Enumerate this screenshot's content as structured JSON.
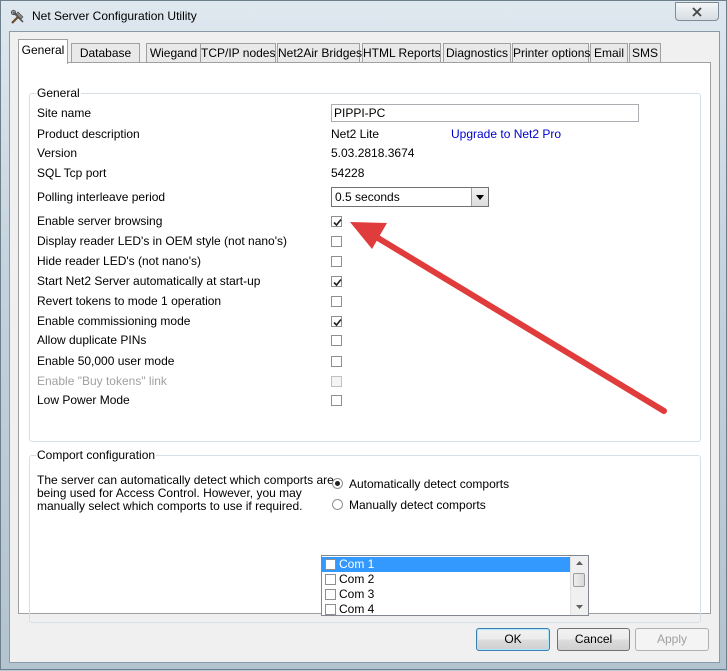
{
  "window": {
    "title": "Net Server Configuration Utility"
  },
  "tabs": [
    "General",
    "Database",
    "Wiegand",
    "TCP/IP nodes",
    "Net2Air Bridges",
    "HTML Reports",
    "Diagnostics",
    "Printer options",
    "Email",
    "SMS"
  ],
  "general_group": {
    "title": "General",
    "site_name": {
      "label": "Site name",
      "value": "PIPPI-PC"
    },
    "product_description": {
      "label": "Product description",
      "value": "Net2 Lite",
      "link": "Upgrade to Net2 Pro"
    },
    "version": {
      "label": "Version",
      "value": "5.03.2818.3674"
    },
    "sql_port": {
      "label": "SQL Tcp port",
      "value": "54228"
    },
    "polling": {
      "label": "Polling interleave period",
      "value": "0.5 seconds"
    },
    "options": [
      {
        "label": "Enable server browsing",
        "checked": true,
        "enabled": true
      },
      {
        "label": "Display reader LED's in OEM style (not nano's)",
        "checked": false,
        "enabled": true
      },
      {
        "label": "Hide reader LED's  (not nano's)",
        "checked": false,
        "enabled": true
      },
      {
        "label": "Start Net2 Server automatically at start-up",
        "checked": true,
        "enabled": true
      },
      {
        "label": "Revert tokens to mode 1 operation",
        "checked": false,
        "enabled": true
      },
      {
        "label": "Enable commissioning mode",
        "checked": true,
        "enabled": true
      },
      {
        "label": "Allow duplicate PINs",
        "checked": false,
        "enabled": true
      },
      {
        "label": "Enable 50,000 user mode",
        "checked": false,
        "enabled": true
      },
      {
        "label": "Enable \"Buy tokens\" link",
        "checked": false,
        "enabled": false
      },
      {
        "label": "Low Power Mode",
        "checked": false,
        "enabled": true
      }
    ]
  },
  "comport_group": {
    "title": "Comport configuration",
    "description": [
      "The server can automatically detect which comports are",
      "being used for Access Control. However, you may",
      "manually select which comports to use if required."
    ],
    "auto_label": "Automatically detect comports",
    "manual_label": "Manually detect comports",
    "selected_mode": "auto",
    "ports": [
      {
        "label": "Com 1",
        "checked": false,
        "selected": true
      },
      {
        "label": "Com 2",
        "checked": false,
        "selected": false
      },
      {
        "label": "Com 3",
        "checked": false,
        "selected": false
      },
      {
        "label": "Com 4",
        "checked": false,
        "selected": false
      }
    ]
  },
  "buttons": {
    "ok": "OK",
    "cancel": "Cancel",
    "apply": "Apply"
  },
  "colors": {
    "annotation_arrow": "#e03c3c",
    "link": "#0000cc",
    "selection": "#3399ff"
  }
}
